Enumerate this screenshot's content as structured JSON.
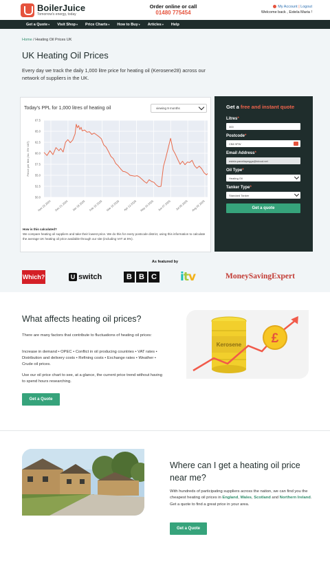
{
  "header": {
    "brand": "BoilerJuice",
    "tagline": "Tomorrow's energy, today",
    "order_title": "Order online or call",
    "phone": "01480 775454",
    "my_account": "My Account",
    "logout": "Logout",
    "welcome": "Welcome back , Estela Maria !"
  },
  "nav": [
    {
      "label": "Get a Quote"
    },
    {
      "label": "Visit Shop"
    },
    {
      "label": "Price Charts"
    },
    {
      "label": "How to Buy"
    },
    {
      "label": "Articles"
    },
    {
      "label": "Help"
    }
  ],
  "breadcrumb": {
    "home": "Home",
    "sep": " / ",
    "current": "Heating Oil Prices UK"
  },
  "page_title": "UK Heating Oil Prices",
  "intro": "Every day we track the daily 1,000 litre price for heating oil (Kerosene28) across our network of suppliers in the UK.",
  "chart_card": {
    "title": "Today's PPL for 1,000 litres of heating oil",
    "period": "viewing 9 months",
    "how_title": "How is this calculated?",
    "how_text": "We compare heating oil suppliers and take their lowest price. We do this for every postcode district, using this information to calculate the average UK heating oil price available through our site (including VAT at 5%)."
  },
  "chart_data": {
    "type": "line",
    "ylabel": "Pence per litre (Inc. 5% VAT)",
    "ylim": [
      50,
      67.5
    ],
    "yticks": [
      "67.5",
      "65.0",
      "62.5",
      "60.0",
      "57.5",
      "55.0",
      "52.5",
      "50.0"
    ],
    "xticks": [
      "Nov 23 2024",
      "Dec 21 2024",
      "Jan 18 2025",
      "Feb 15 2025",
      "Mar 15 2025",
      "Apr 12 2025",
      "May 10 2025",
      "Jun 07 2025",
      "Jul 05 2025",
      "Aug 02 2025"
    ],
    "x_days": [
      0,
      5,
      10,
      15,
      20,
      25,
      28,
      32,
      36,
      40,
      44,
      48,
      52,
      54,
      56,
      58,
      60,
      62,
      64,
      68,
      72,
      76,
      80,
      84,
      88,
      92,
      96,
      100,
      104,
      108,
      112,
      116,
      120,
      124,
      128,
      132,
      136,
      140,
      144,
      148,
      152,
      156,
      160,
      164,
      168,
      172,
      176,
      180,
      184,
      188,
      192,
      196,
      200,
      204,
      208,
      212,
      216,
      220,
      224,
      228,
      232,
      236,
      240,
      244,
      248,
      252,
      256,
      260,
      264,
      268,
      272,
      274
    ],
    "values": [
      60.2,
      59.5,
      60.6,
      59.7,
      61.3,
      60.6,
      61.1,
      60.3,
      62.5,
      63.1,
      62.4,
      63.0,
      64.4,
      66.6,
      65.8,
      66.3,
      65.4,
      65.9,
      65.1,
      65.3,
      64.8,
      64.9,
      64.3,
      64.6,
      64.2,
      63.8,
      63.3,
      61.9,
      61.4,
      60.4,
      59.3,
      58.8,
      57.7,
      57.2,
      56.5,
      55.9,
      55.8,
      55.5,
      55.0,
      54.9,
      54.8,
      54.9,
      54.6,
      54.1,
      53.6,
      53.2,
      54.0,
      53.6,
      53.4,
      52.8,
      52.4,
      52.5,
      57.0,
      59.0,
      61.2,
      63.4,
      60.8,
      59.8,
      58.6,
      57.5,
      58.2,
      57.4,
      58.0,
      57.9,
      58.4,
      57.2,
      56.6,
      57.1,
      56.5,
      55.6,
      55.1,
      55.4
    ]
  },
  "quote_panel": {
    "title_a": "Get a ",
    "title_b": "free and instant quote",
    "litres_label": "Litres",
    "litres_value": "300",
    "postcode_label": "Postcode",
    "postcode_value": "CB8 9PW",
    "email_label": "Email Address",
    "email_value": "estela.paneliapeggs@icloud.net",
    "oil_label": "Oil Type",
    "oil_value": "Heating Oil",
    "tanker_label": "Tanker Type",
    "tanker_value": "Standard Tanker",
    "button": "Get a quote"
  },
  "featured": {
    "label": "As featured by",
    "logos": [
      "Which?",
      "U switch",
      "BBC",
      "itv",
      "MoneySavingExpert"
    ]
  },
  "section_affects": {
    "title": "What affects heating oil prices?",
    "p1": "There are many factors that contribute to fluctuations of heating oil prices:",
    "p2": "Increase in demand • OPEC • Conflict in oil producing countries • VAT rates • Distribution and delivery costs • Refining costs • Exchange rates • Weather • Crude oil prices.",
    "p3": "Use our oil price chart to see, at a glance, the current price trend without having to spend hours researching.",
    "button": "Get a Quote",
    "illustration_label": "Kerosene",
    "illustration_symbol": "£"
  },
  "section_near": {
    "title": "Where can I get a heating oil price near me?",
    "p_a": "With hundreds of participating suppliers across the nation, we can find you the cheapest heating oil prices in ",
    "england": "England",
    "comma1": ", ",
    "wales": "Wales",
    "comma2": ", ",
    "scotland": "Scotland",
    "and": " and ",
    "ni": "Northern Ireland",
    "p_b": ". Get a quote to find a great price in your area.",
    "button": "Get a Quote"
  }
}
